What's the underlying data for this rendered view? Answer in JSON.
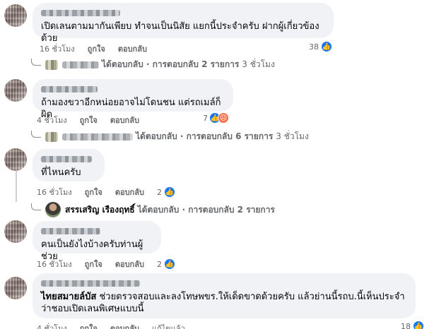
{
  "comments": [
    {
      "text": "เปิดเลนตามมากันเพียบ ทำจนเป็นนิสัย แยกนี้ประจำครับ ฝากผู้เกี่ยวข้องด้วย",
      "time": "16 ชั่วโมง",
      "like_label": "ถูกใจ",
      "reply_label": "ตอบกลับ",
      "reaction_count": "38",
      "reply_summary": "ได้ตอบกลับ · การตอบกลับ 2 รายการ",
      "reply_time": "3 ชั่วโมง"
    },
    {
      "text": "ถ้ามองขวาอีกหน่อยอาจไม่โดนชน แต่รถเมล์ก็ผิด",
      "time": "4 ชั่วโมง",
      "like_label": "ถูกใจ",
      "reply_label": "ตอบกลับ",
      "reaction_count": "7",
      "reply_summary": "ได้ตอบกลับ · การตอบกลับ 6 รายการ",
      "reply_time": "3 ชั่วโมง"
    },
    {
      "text": "ที่ไหนครับ",
      "time": "16 ชั่วโมง",
      "like_label": "ถูกใจ",
      "reply_label": "ตอบกลับ",
      "reaction_count": "2",
      "reply_author": "สรรเสริญ เรืองฤทธิ์",
      "reply_summary": "ได้ตอบกลับ · การตอบกลับ 2 รายการ"
    },
    {
      "text": "คนเป็นยังไงบ้างครับท่านผู้ช่วย",
      "time": "16 ชั่วโมง",
      "like_label": "ถูกใจ",
      "reply_label": "ตอบกลับ",
      "reaction_count": "2"
    },
    {
      "mention": "ไทยสมายล์บัส",
      "text": " ช่วยตรวจสอบและลงโทษพขร.ให้เด็ดขาดด้วยครับ แล้วย่านนี้รถบ.นี้เห็นประจำว่าชอบเปิดเลนพิเศษแบบนี้",
      "time": "4 ชั่วโมง",
      "like_label": "ถูกใจ",
      "reply_label": "ตอบกลับ",
      "edited_label": "แก้ไขแล้ว",
      "reaction_count": "18"
    }
  ],
  "icons": {
    "like": "thumbs-up-icon",
    "angry": "angry-face-icon",
    "reply": "reply-arrow-icon"
  },
  "colors": {
    "like": "#1877f2",
    "angry": "#f7714c",
    "bubble": "#f0f2f5",
    "meta": "#65676b"
  }
}
